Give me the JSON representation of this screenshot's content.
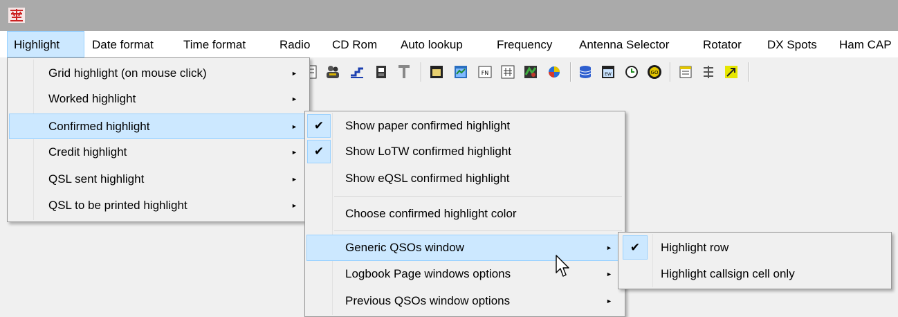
{
  "menubar": {
    "items": [
      "Highlight",
      "Date format",
      "Time format",
      "Radio",
      "CD Rom",
      "Auto lookup",
      "Frequency",
      "Antenna Selector",
      "Rotator",
      "DX Spots",
      "Ham CAP"
    ]
  },
  "highlight_menu": {
    "items": [
      {
        "label": "Grid highlight (on mouse click)",
        "submenu": true
      },
      {
        "label": "Worked highlight",
        "submenu": true
      },
      {
        "label": "Confirmed highlight",
        "submenu": true,
        "highlighted": true
      },
      {
        "label": "Credit highlight",
        "submenu": true
      },
      {
        "label": "QSL sent highlight",
        "submenu": true
      },
      {
        "label": "QSL to be printed highlight",
        "submenu": true
      }
    ]
  },
  "confirmed_menu": {
    "items": [
      {
        "label": "Show paper confirmed highlight",
        "checked": true
      },
      {
        "label": "Show LoTW confirmed highlight",
        "checked": true
      },
      {
        "label": "Show eQSL confirmed highlight",
        "checked": false
      },
      {
        "label": "Choose confirmed highlight color"
      },
      {
        "label": "Generic QSOs window",
        "submenu": true,
        "highlighted": true
      },
      {
        "label": "Logbook Page windows options",
        "submenu": true
      },
      {
        "label": "Previous QSOs window options",
        "submenu": true
      }
    ]
  },
  "generic_menu": {
    "items": [
      {
        "label": "Highlight row",
        "checked": true
      },
      {
        "label": "Highlight callsign cell only",
        "checked": false
      }
    ]
  },
  "icons": {
    "submenu_arrow": "►",
    "check": "✔"
  }
}
